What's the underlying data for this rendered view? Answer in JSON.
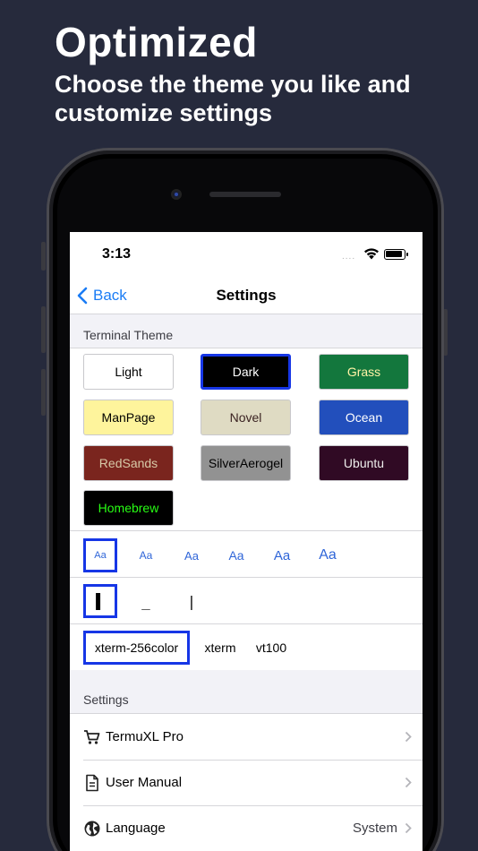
{
  "promo": {
    "title": "Optimized",
    "subtitle": "Choose the theme you like and customize settings"
  },
  "status_bar": {
    "time": "3:13",
    "signal": "....",
    "icons": [
      "wifi-icon",
      "battery-icon"
    ]
  },
  "nav": {
    "back_label": "Back",
    "title": "Settings",
    "accent_color": "#1a7cf5"
  },
  "terminal_theme": {
    "header": "Terminal Theme",
    "selected": "Dark",
    "themes": [
      {
        "label": "Light",
        "bg": "#ffffff",
        "fg": "#000000"
      },
      {
        "label": "Dark",
        "bg": "#000000",
        "fg": "#ffffff"
      },
      {
        "label": "Grass",
        "bg": "#13773d",
        "fg": "#fff3a6"
      },
      {
        "label": "ManPage",
        "bg": "#fef49c",
        "fg": "#000000"
      },
      {
        "label": "Novel",
        "bg": "#dfdbc3",
        "fg": "#3b2322"
      },
      {
        "label": "Ocean",
        "bg": "#224fbc",
        "fg": "#ffffff"
      },
      {
        "label": "RedSands",
        "bg": "#7a251e",
        "fg": "#d7c9a7"
      },
      {
        "label": "SilverAerogel",
        "bg": "#929292",
        "fg": "#000000"
      },
      {
        "label": "Ubuntu",
        "bg": "#300a24",
        "fg": "#eeeeec"
      },
      {
        "label": "Homebrew",
        "bg": "#000000",
        "fg": "#28fe14"
      }
    ]
  },
  "font_sizes": {
    "label": "Aa",
    "count": 6,
    "selected_index": 0
  },
  "cursor_styles": {
    "options": [
      "block",
      "underline",
      "bar"
    ],
    "glyphs": [
      "▌",
      "_",
      "|"
    ],
    "selected_index": 0
  },
  "terminal_types": {
    "options": [
      "xterm-256color",
      "xterm",
      "vt100"
    ],
    "selected_index": 0
  },
  "settings": {
    "header": "Settings",
    "rows": [
      {
        "label": "TermuXL Pro",
        "icon": "cart-icon",
        "value": ""
      },
      {
        "label": "User Manual",
        "icon": "document-icon",
        "value": ""
      },
      {
        "label": "Language",
        "icon": "globe-icon",
        "value": "System"
      }
    ]
  }
}
